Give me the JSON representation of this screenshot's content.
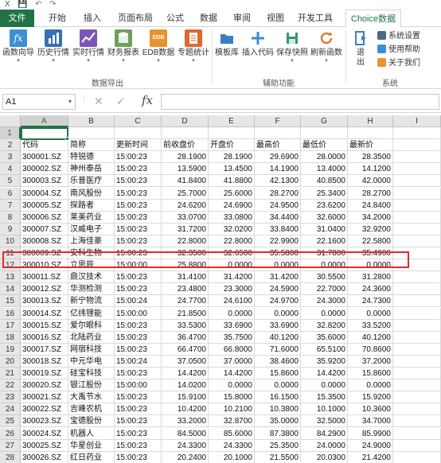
{
  "quick_access": {
    "save": "💾",
    "undo": "↶",
    "redo": "↷"
  },
  "tabs": [
    {
      "label": "文件"
    },
    {
      "label": "开始"
    },
    {
      "label": "插入"
    },
    {
      "label": "页面布局"
    },
    {
      "label": "公式"
    },
    {
      "label": "数据"
    },
    {
      "label": "审阅"
    },
    {
      "label": "视图"
    },
    {
      "label": "开发工具"
    },
    {
      "label": "Choice数据"
    }
  ],
  "ribbon": {
    "data_export": {
      "buttons": [
        {
          "label": "函数向导",
          "icon": "fx-icon",
          "color": "#3d8fd6"
        },
        {
          "label": "历史行情",
          "icon": "bar-chart-icon",
          "color": "#3a6fb5"
        },
        {
          "label": "实时行情",
          "icon": "realtime-chart-icon",
          "color": "#7a56b8"
        },
        {
          "label": "财务报表",
          "icon": "database-icon",
          "color": "#6da05a"
        },
        {
          "label": "EDB数据",
          "icon": "edb-icon",
          "color": "#e8932f"
        },
        {
          "label": "专题统计",
          "icon": "report-icon",
          "color": "#e06a2a"
        }
      ],
      "group_label": "数据导出"
    },
    "helper": {
      "buttons": [
        {
          "label": "模板库",
          "icon": "folder-icon",
          "color": "#3a7fc4"
        },
        {
          "label": "插入代码",
          "icon": "plus-icon",
          "color": "#3a8fd6"
        },
        {
          "label": "保存快照",
          "icon": "save-icon",
          "color": "#2e9a6a"
        },
        {
          "label": "刷新函数",
          "icon": "refresh-icon",
          "color": "#e07a2a"
        }
      ],
      "group_label": "辅助功能"
    },
    "system": {
      "exit_label": "退出",
      "items": [
        {
          "label": "系统设置",
          "icon": "gear-icon"
        },
        {
          "label": "使用帮助",
          "icon": "help-icon"
        },
        {
          "label": "关于我们",
          "icon": "info-icon"
        }
      ],
      "group_label": "系统"
    }
  },
  "formula_bar": {
    "cell_ref": "A1",
    "fx": "fx",
    "cancel": "✕",
    "enter": "✓",
    "value": ""
  },
  "columns": [
    "A",
    "B",
    "C",
    "D",
    "E",
    "F",
    "G",
    "H",
    "I"
  ],
  "headers": [
    "代码",
    "简称",
    "更新时间",
    "前收盘价",
    "开盘价",
    "最高价",
    "最低价",
    "最新价"
  ],
  "rows": [
    [
      "300001.SZ",
      "特锐德",
      "15:00:23",
      "28.1900",
      "28.1900",
      "29.6900",
      "28.0000",
      "28.3500"
    ],
    [
      "300002.SZ",
      "神州泰岳",
      "15:00:23",
      "13.5900",
      "13.4500",
      "14.1900",
      "13.4000",
      "14.1200"
    ],
    [
      "300003.SZ",
      "乐普医疗",
      "15:00:23",
      "41.8400",
      "41.8800",
      "42.1300",
      "40.8500",
      "42.0000"
    ],
    [
      "300004.SZ",
      "南风股份",
      "15:00:23",
      "25.7000",
      "25.6000",
      "28.2700",
      "25.3400",
      "28.2700"
    ],
    [
      "300005.SZ",
      "探路者",
      "15:00:23",
      "24.6200",
      "24.6900",
      "24.9500",
      "23.6200",
      "24.8400"
    ],
    [
      "300006.SZ",
      "莱美药业",
      "15:00:23",
      "33.0700",
      "33.0800",
      "34.4400",
      "32.6000",
      "34.2000"
    ],
    [
      "300007.SZ",
      "汉威电子",
      "15:00:23",
      "31.7200",
      "32.0200",
      "33.8400",
      "31.0400",
      "32.9200"
    ],
    [
      "300008.SZ",
      "上海佳豪",
      "15:00:23",
      "22.8000",
      "22.8000",
      "22.9900",
      "22.1600",
      "22.5800"
    ],
    [
      "300009.SZ",
      "安科生物",
      "15:00:23",
      "32.3500",
      "32.6500",
      "35.5800",
      "31.7800",
      "35.4900"
    ],
    [
      "300010.SZ",
      "立思辰",
      "15:00:00",
      "25.8800",
      "0.0000",
      "0.0000",
      "0.0000",
      "0.0000"
    ],
    [
      "300011.SZ",
      "鼎汉技术",
      "15:00:23",
      "31.4100",
      "31.4200",
      "31.4200",
      "30.5500",
      "31.2800"
    ],
    [
      "300012.SZ",
      "华测检测",
      "15:00:23",
      "23.4800",
      "23.3000",
      "24.5900",
      "22.7000",
      "24.3600"
    ],
    [
      "300013.SZ",
      "新宁物流",
      "15:00:24",
      "24.7700",
      "24.6100",
      "24.9700",
      "24.3000",
      "24.7300"
    ],
    [
      "300014.SZ",
      "亿纬锂能",
      "15:00:00",
      "21.8500",
      "0.0000",
      "0.0000",
      "0.0000",
      "0.0000"
    ],
    [
      "300015.SZ",
      "爱尔眼科",
      "15:00:23",
      "33.5300",
      "33.6900",
      "33.6900",
      "32.8200",
      "33.5200"
    ],
    [
      "300016.SZ",
      "北陆药业",
      "15:00:23",
      "36.4700",
      "35.7500",
      "40.1200",
      "35.6000",
      "40.1200"
    ],
    [
      "300017.SZ",
      "网宿科技",
      "15:00:23",
      "66.4700",
      "66.8000",
      "71.6000",
      "65.5100",
      "70.8600"
    ],
    [
      "300018.SZ",
      "中元华电",
      "15:00:24",
      "37.0500",
      "37.0000",
      "38.4600",
      "35.9200",
      "37.2000"
    ],
    [
      "300019.SZ",
      "硅宝科技",
      "15:00:23",
      "14.4200",
      "14.4200",
      "15.8600",
      "14.4200",
      "15.8600"
    ],
    [
      "300020.SZ",
      "银江股份",
      "15:00:00",
      "14.0200",
      "0.0000",
      "0.0000",
      "0.0000",
      "0.0000"
    ],
    [
      "300021.SZ",
      "大禹节水",
      "15:00:23",
      "15.9100",
      "15.8000",
      "16.1500",
      "15.3500",
      "15.9200"
    ],
    [
      "300022.SZ",
      "吉峰农机",
      "15:00:23",
      "10.4200",
      "10.2100",
      "10.3800",
      "10.1000",
      "10.3600"
    ],
    [
      "300023.SZ",
      "宝德股份",
      "15:00:23",
      "33.2000",
      "32.8700",
      "35.0000",
      "32.5000",
      "34.7000"
    ],
    [
      "300024.SZ",
      "机器人",
      "15:00:23",
      "84.5000",
      "85.6000",
      "87.3800",
      "84.2900",
      "85.9900"
    ],
    [
      "300025.SZ",
      "华星创业",
      "15:00:23",
      "24.3300",
      "24.3300",
      "25.3500",
      "24.0000",
      "24.9000"
    ],
    [
      "300026.SZ",
      "红日药业",
      "15:00:23",
      "20.2400",
      "20.1000",
      "21.5500",
      "20.0300",
      "21.4200"
    ],
    [
      "300027.SZ",
      "华谊兄弟",
      "15:00:23",
      "40.7000",
      "40.7100",
      "41.1100",
      "39.6000",
      "40.4200"
    ]
  ],
  "row_numbers": [
    "1",
    "2",
    "3",
    "4",
    "5",
    "6",
    "7",
    "8",
    "9",
    "10",
    "11",
    "12",
    "13",
    "14",
    "15",
    "16",
    "17",
    "18",
    "19",
    "20",
    "21",
    "22",
    "23",
    "24",
    "25",
    "26",
    "27",
    "28",
    "29"
  ],
  "colors": {
    "excel_green": "#217346",
    "highlight_red": "#e02a2a"
  }
}
